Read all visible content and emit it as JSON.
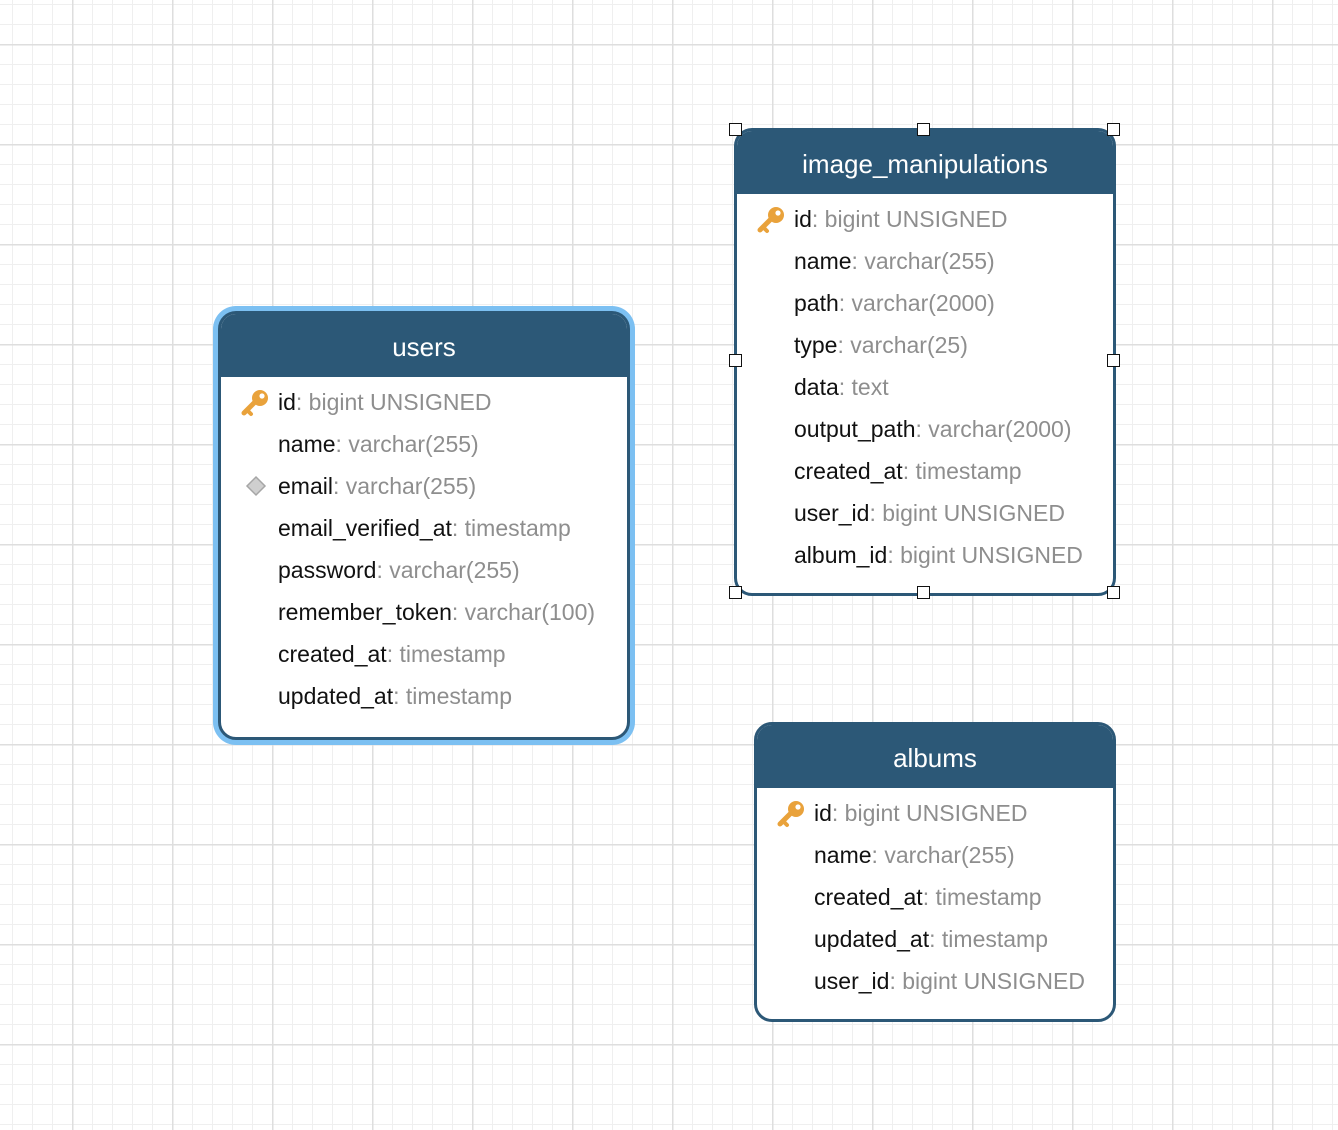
{
  "colors": {
    "header": "#2c5877",
    "selection_glow": "#7cc0f2",
    "key_icon": "#e9a23b",
    "attribute_type": "#8e8e8e"
  },
  "tables": {
    "users": {
      "title": "users",
      "selected": true,
      "attributes": [
        {
          "name": "id",
          "type": ": bigint UNSIGNED",
          "icon": "primary-key-icon"
        },
        {
          "name": "name",
          "type": ": varchar(255)",
          "icon": ""
        },
        {
          "name": "email",
          "type": ": varchar(255)",
          "icon": "unique-index-icon"
        },
        {
          "name": "email_verified_at",
          "type": ": timestamp",
          "icon": ""
        },
        {
          "name": "password",
          "type": ": varchar(255)",
          "icon": ""
        },
        {
          "name": "remember_token",
          "type": ": varchar(100)",
          "icon": ""
        },
        {
          "name": "created_at",
          "type": ": timestamp",
          "icon": ""
        },
        {
          "name": "updated_at",
          "type": ": timestamp",
          "icon": ""
        }
      ]
    },
    "image_manipulations": {
      "title": "image_manipulations",
      "selected": false,
      "resize_handles_visible": true,
      "attributes": [
        {
          "name": "id",
          "type": ": bigint UNSIGNED",
          "icon": "primary-key-icon"
        },
        {
          "name": "name",
          "type": ": varchar(255)",
          "icon": ""
        },
        {
          "name": "path",
          "type": ": varchar(2000)",
          "icon": ""
        },
        {
          "name": "type",
          "type": ": varchar(25)",
          "icon": ""
        },
        {
          "name": "data",
          "type": ": text",
          "icon": ""
        },
        {
          "name": "output_path",
          "type": ": varchar(2000)",
          "icon": ""
        },
        {
          "name": "created_at",
          "type": ": timestamp",
          "icon": ""
        },
        {
          "name": "user_id",
          "type": ": bigint UNSIGNED",
          "icon": ""
        },
        {
          "name": "album_id",
          "type": ": bigint UNSIGNED",
          "icon": ""
        }
      ]
    },
    "albums": {
      "title": "albums",
      "selected": false,
      "attributes": [
        {
          "name": "id",
          "type": ": bigint UNSIGNED",
          "icon": "primary-key-icon"
        },
        {
          "name": "name",
          "type": ": varchar(255)",
          "icon": ""
        },
        {
          "name": "created_at",
          "type": ": timestamp",
          "icon": ""
        },
        {
          "name": "updated_at",
          "type": ": timestamp",
          "icon": ""
        },
        {
          "name": "user_id",
          "type": ": bigint UNSIGNED",
          "icon": ""
        }
      ]
    }
  }
}
